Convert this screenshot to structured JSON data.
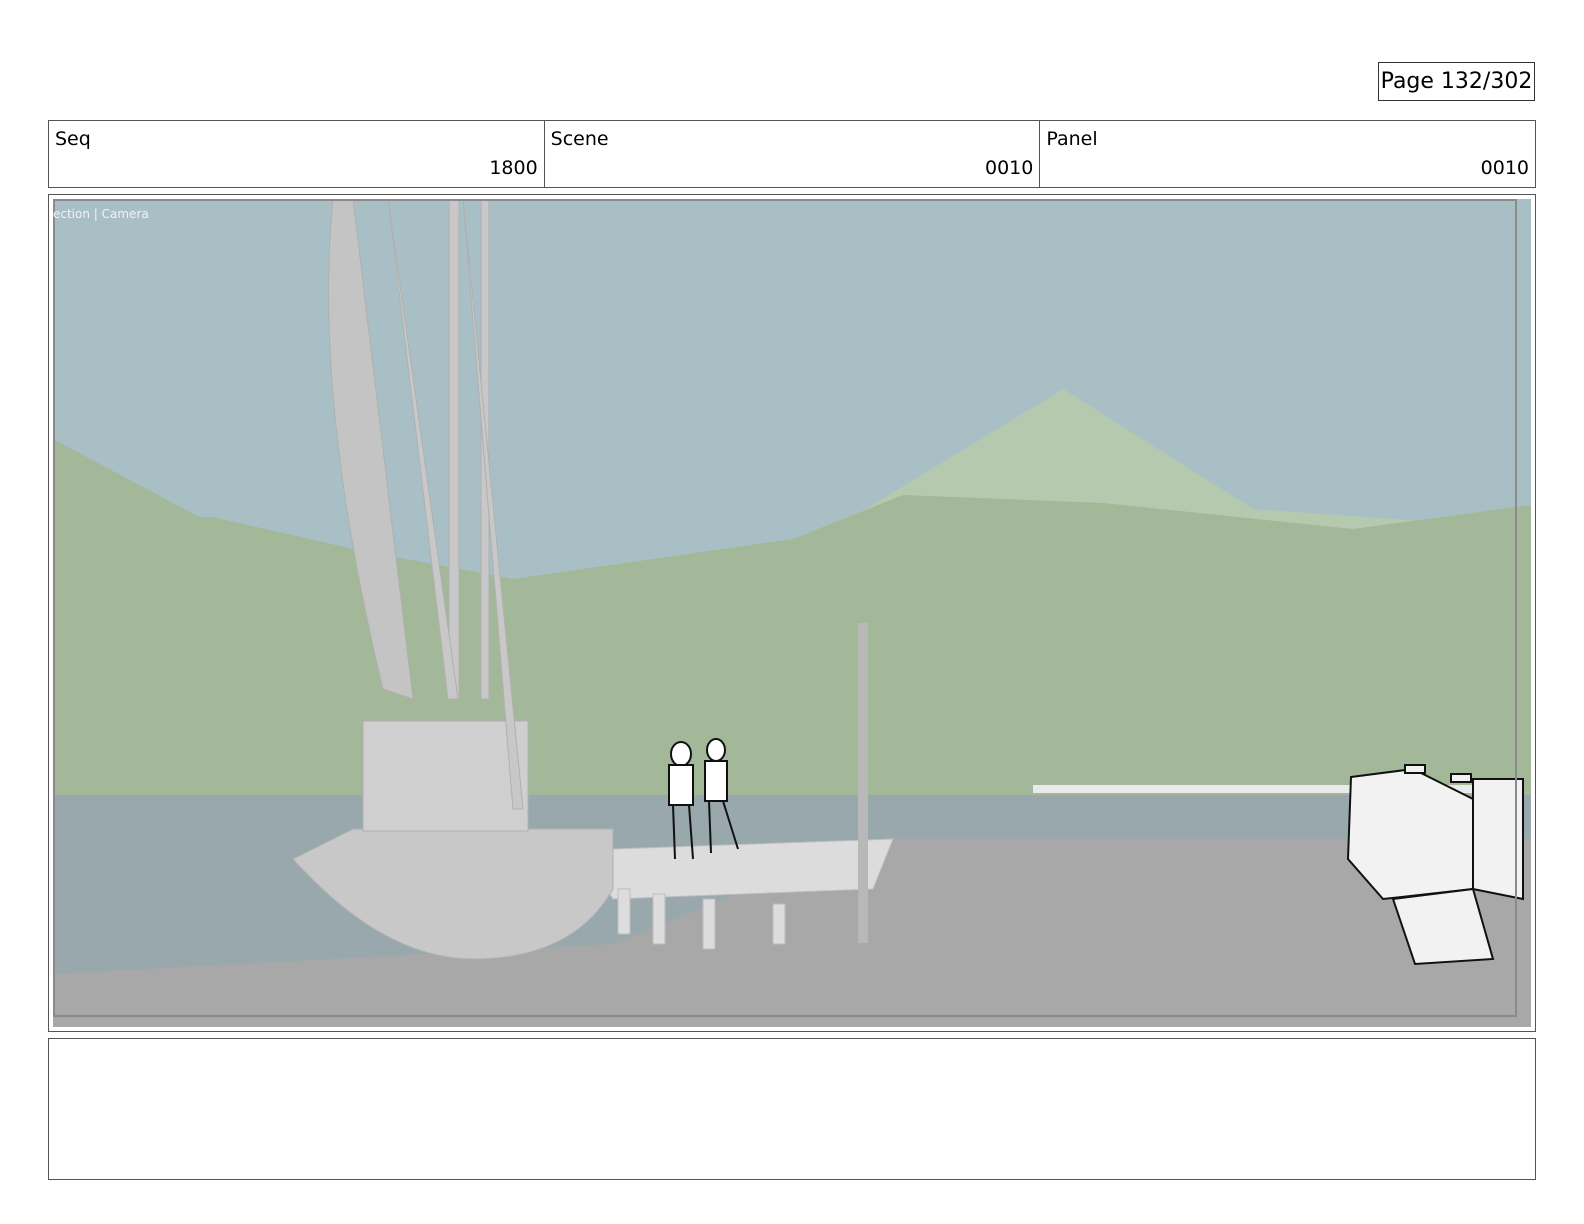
{
  "page": {
    "label": "Page 132/302"
  },
  "header": {
    "seq": {
      "label": "Seq",
      "value": "1800"
    },
    "scene": {
      "label": "Scene",
      "value": "0010"
    },
    "panel": {
      "label": "Panel",
      "value": "0010"
    }
  },
  "frame": {
    "overlay_text": "ection | Camera"
  },
  "notes": {
    "text": ""
  },
  "colors": {
    "sky": "#a9bfc6",
    "hills": "#a2b898",
    "far_peak": "#b5c9ae",
    "water": "#98a8ac",
    "dock": "#a8a8a8"
  }
}
